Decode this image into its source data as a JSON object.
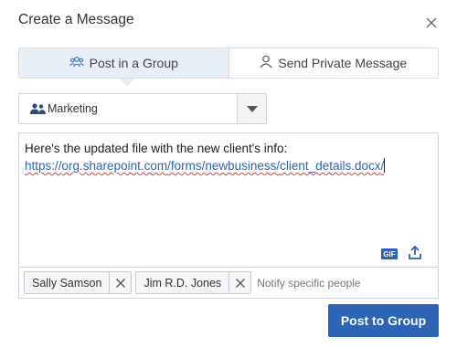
{
  "dialog": {
    "title": "Create a Message",
    "close_icon": "close-icon"
  },
  "tabs": [
    {
      "label": "Post in a Group",
      "icon": "group-icon",
      "active": true
    },
    {
      "label": "Send Private Message",
      "icon": "person-icon",
      "active": false
    }
  ],
  "group_select": {
    "selected": "Marketing",
    "icon": "people-icon"
  },
  "editor": {
    "line1": "Here's the updated file with the new client's info:",
    "link_parts": [
      "https://",
      "org.sharepoint.com",
      "/forms/",
      "newbusiness",
      "/",
      "client_details.docx",
      "/"
    ],
    "gif_label": "GIF",
    "upload_icon": "upload-icon"
  },
  "recipients": {
    "chips": [
      "Sally Samson",
      "Jim R.D. Jones"
    ],
    "placeholder": "Notify specific people"
  },
  "submit": {
    "label": "Post to Group"
  },
  "colors": {
    "accent": "#2e64b5",
    "active_tab": "#e8eef5",
    "link": "#2d63b8"
  }
}
